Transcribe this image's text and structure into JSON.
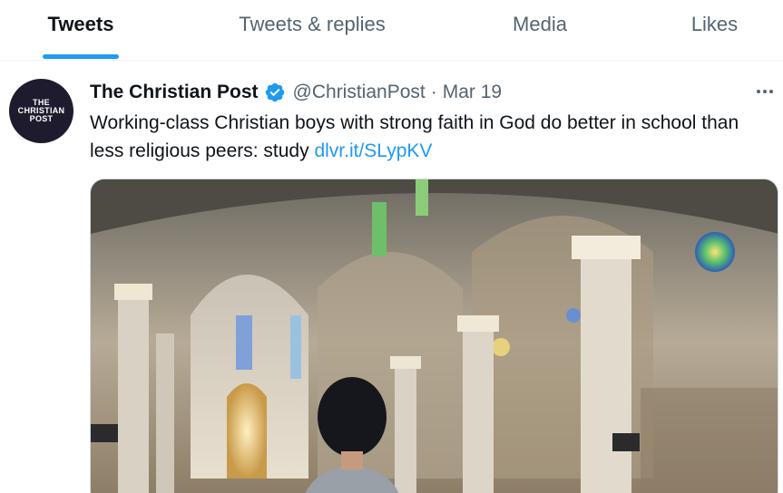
{
  "tabs": [
    {
      "label": "Tweets",
      "active": true
    },
    {
      "label": "Tweets & replies",
      "active": false
    },
    {
      "label": "Media",
      "active": false
    },
    {
      "label": "Likes",
      "active": false
    }
  ],
  "tweet": {
    "avatar": {
      "line1": "THE",
      "line2": "CHRISTIAN",
      "line3": "POST"
    },
    "display_name": "The Christian Post",
    "verified_icon": "verified-badge-icon",
    "handle": "@ChristianPost",
    "separator": "·",
    "date": "Mar 19",
    "text": "Working-class Christian boys with strong faith in God do better in school than less religious peers: study ",
    "link": "dlvr.it/SLypKV",
    "more_icon": "more-options-icon",
    "media_icon": "photo-church-interior"
  },
  "colors": {
    "accent": "#1d9bf0",
    "text_primary": "#0f1419",
    "text_secondary": "#536471",
    "border": "#eff3f4"
  }
}
